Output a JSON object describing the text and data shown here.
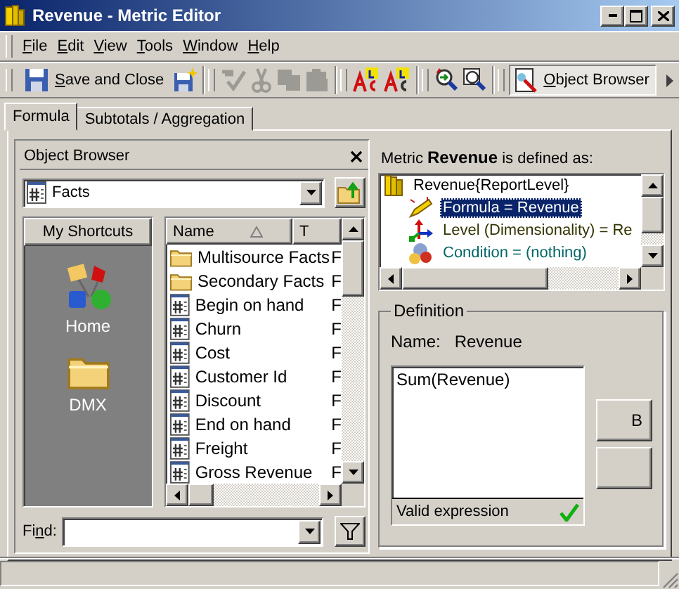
{
  "window": {
    "title": "Revenue - Metric Editor"
  },
  "menu": [
    {
      "label": "File"
    },
    {
      "label": "Edit"
    },
    {
      "label": "View"
    },
    {
      "label": "Tools"
    },
    {
      "label": "Window"
    },
    {
      "label": "Help"
    }
  ],
  "toolbar": [
    {
      "kind": "button",
      "label": "Save and Close"
    },
    {
      "kind": "icon",
      "disabled": false
    },
    {
      "kind": "separator"
    },
    {
      "kind": "icon",
      "disabled": true
    },
    {
      "kind": "icon",
      "disabled": true
    },
    {
      "kind": "icon",
      "disabled": true
    },
    {
      "kind": "icon",
      "disabled": true
    },
    {
      "kind": "separator"
    },
    {
      "kind": "icon",
      "disabled": false
    },
    {
      "kind": "icon",
      "disabled": false
    },
    {
      "kind": "separator"
    },
    {
      "kind": "icon",
      "disabled": false
    },
    {
      "kind": "icon",
      "disabled": false
    },
    {
      "kind": "separator"
    },
    {
      "kind": "toggle",
      "label": "Object Browser",
      "pressed": true
    }
  ],
  "tabs": [
    {
      "label": "Formula",
      "selected": true
    },
    {
      "label": "Subtotals / Aggregation",
      "selected": false
    }
  ],
  "object_browser": {
    "title": "Object Browser",
    "folder": "Facts",
    "shortcuts": {
      "title": "My Shortcuts",
      "items": [
        {
          "kind": "home",
          "label": "Home"
        },
        {
          "kind": "folder",
          "label": "DMX"
        }
      ]
    },
    "columns": [
      "Name",
      "T"
    ],
    "rows": [
      {
        "kind": "folder",
        "name": "Multisource Facts",
        "type": "F"
      },
      {
        "kind": "folder",
        "name": "Secondary Facts",
        "type": "F"
      },
      {
        "kind": "fact",
        "name": "Begin on hand",
        "type": "F"
      },
      {
        "kind": "fact",
        "name": "Churn",
        "type": "F"
      },
      {
        "kind": "fact",
        "name": "Cost",
        "type": "F"
      },
      {
        "kind": "fact",
        "name": "Customer Id",
        "type": "F"
      },
      {
        "kind": "fact",
        "name": "Discount",
        "type": "F"
      },
      {
        "kind": "fact",
        "name": "End on hand",
        "type": "F"
      },
      {
        "kind": "fact",
        "name": "Freight",
        "type": "F"
      },
      {
        "kind": "fact",
        "name": "Gross Revenue",
        "type": "F"
      }
    ],
    "find_label": "Find:"
  },
  "metric": {
    "heading": "Metric **Revenue** is defined as:",
    "tree": {
      "label": "Revenue{ReportLevel}",
      "children": [
        {
          "kind": "formula",
          "label": "Formula = Revenue",
          "selected": true
        },
        {
          "kind": "level",
          "label": "Level (Dimensionality) = Re",
          "selected": false,
          "color": "#333300"
        },
        {
          "kind": "condition",
          "label": "Condition = (nothing)",
          "selected": false,
          "color": "#006666"
        }
      ]
    },
    "definition": {
      "title": "Definition",
      "name_label": "Name:",
      "name": "Revenue",
      "formula": "Sum(Revenue)",
      "status": "Valid expression",
      "valid": true
    },
    "side_buttons": [
      {
        "label": "B"
      }
    ]
  }
}
